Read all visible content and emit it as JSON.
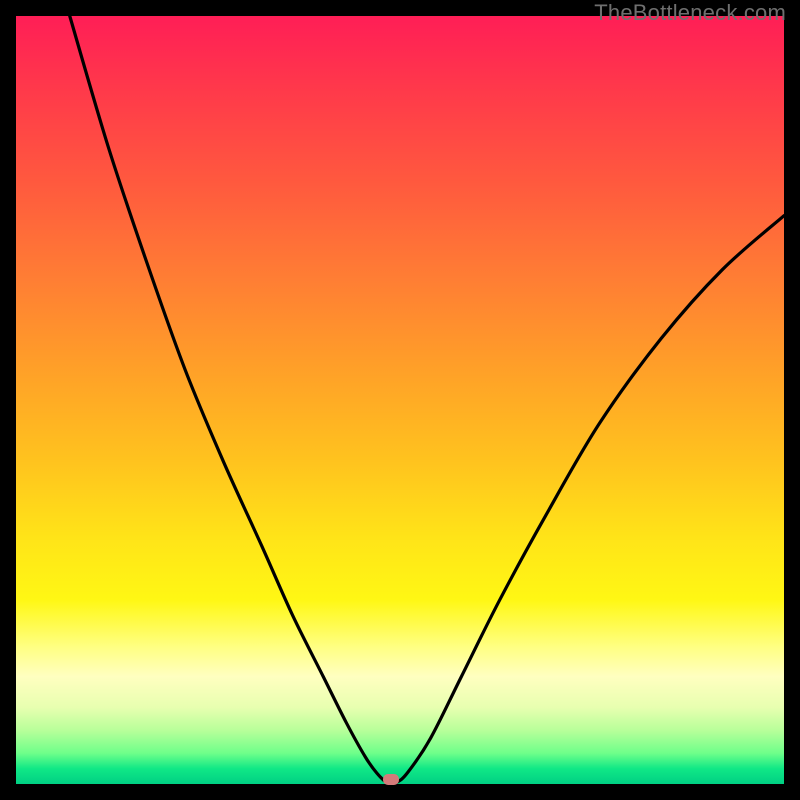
{
  "watermark": "TheBottleneck.com",
  "chart_data": {
    "type": "line",
    "title": "",
    "xlabel": "",
    "ylabel": "",
    "xlim": [
      0,
      100
    ],
    "ylim": [
      0,
      100
    ],
    "grid": false,
    "legend": false,
    "series": [
      {
        "name": "curve",
        "color": "#000000",
        "x": [
          7,
          12,
          17,
          22,
          27,
          32,
          36,
          40,
          43,
          45.5,
          47,
          48.3,
          49.5,
          51,
          54,
          58,
          63,
          69,
          76,
          84,
          92,
          100
        ],
        "y": [
          100,
          83,
          68,
          54,
          42,
          31,
          22,
          14,
          8,
          3.5,
          1.4,
          0.2,
          0.2,
          1.5,
          6,
          14,
          24,
          35,
          47,
          58,
          67,
          74
        ]
      }
    ],
    "marker": {
      "x": 48.8,
      "y": 0.5,
      "color": "#d47a7a"
    },
    "background_gradient": {
      "top": "#ff1e56",
      "mid": "#ffe418",
      "bottom": "#00d084"
    }
  }
}
